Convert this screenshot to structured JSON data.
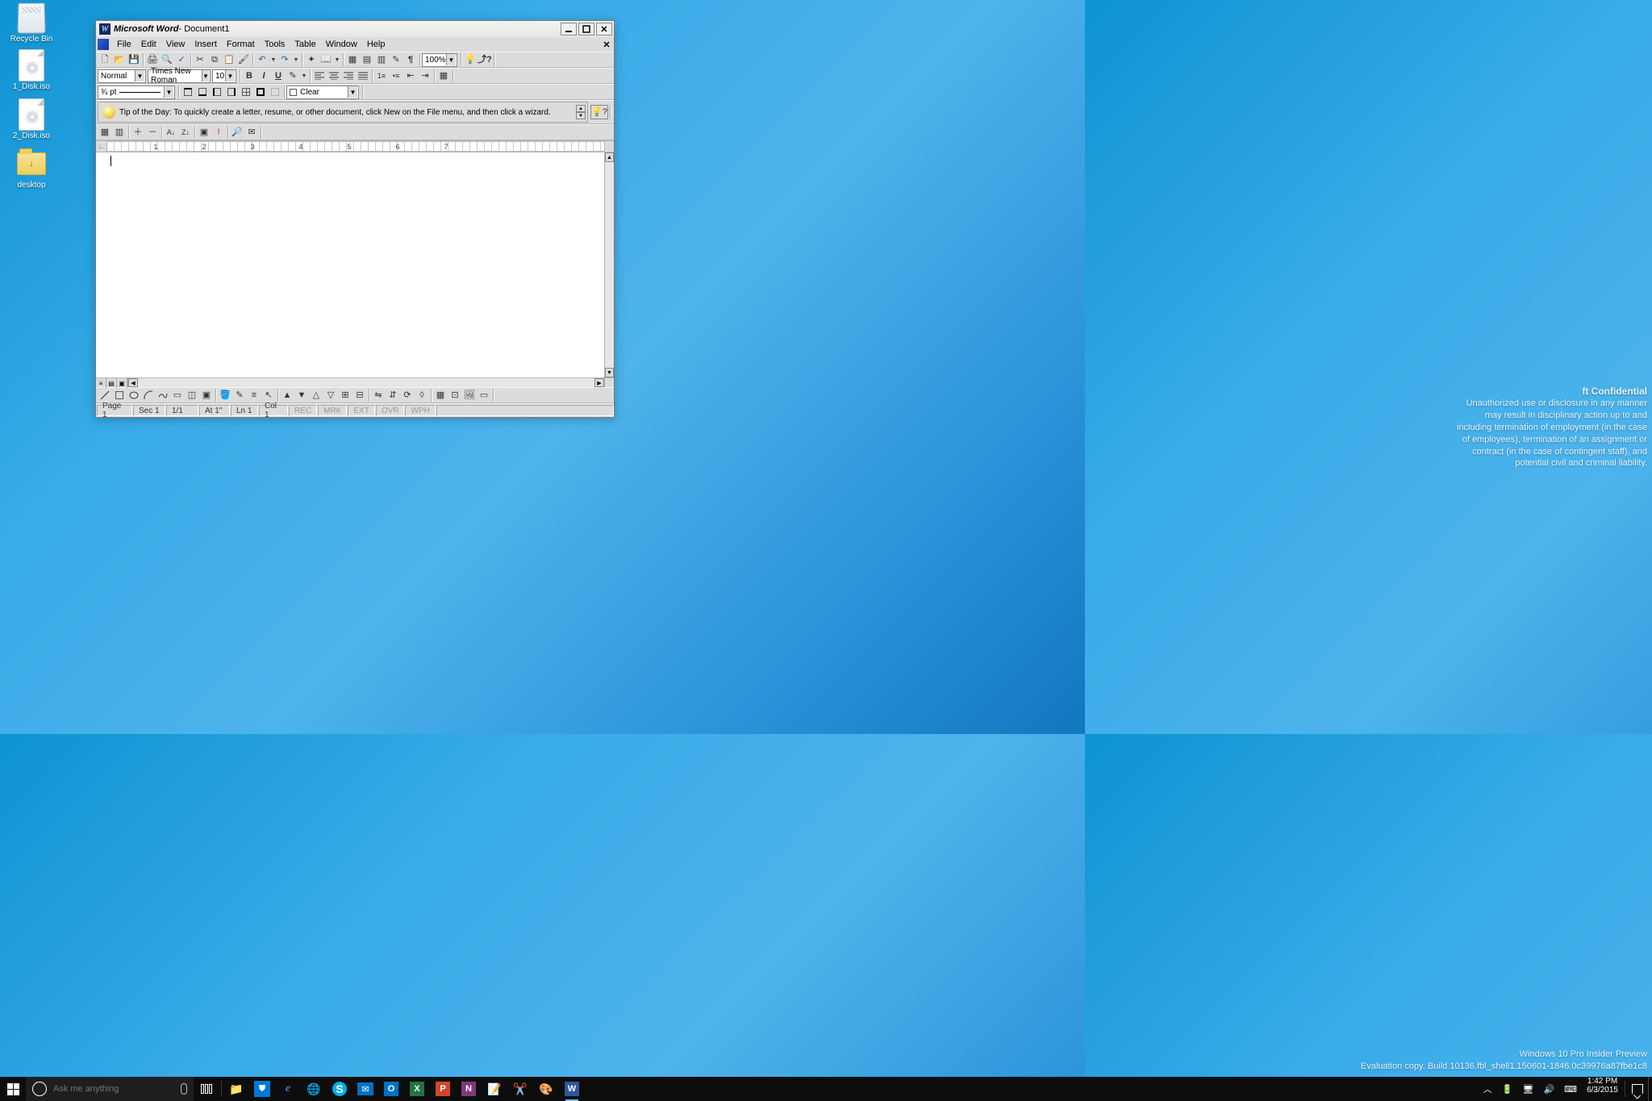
{
  "desktop": {
    "icons": [
      {
        "label": "Recycle Bin"
      },
      {
        "label": "1_Disk.iso"
      },
      {
        "label": "2_Disk.iso"
      },
      {
        "label": "desktop"
      }
    ]
  },
  "confidential": {
    "heading": "ft Confidential",
    "body": "Unauthorized use or disclosure in any manner may result in disciplinary action up to and including termination of employment (in the case of employees), termination of an assignment or contract (in the case of contingent staff), and potential civil and criminal liability.",
    "os": "Windows 10 Pro Insider Preview",
    "build": "Evaluation copy. Build 10136.fbl_shell1.150601-1846.0c39976a87fbe1c8"
  },
  "word": {
    "titlebar": {
      "app": "Microsoft Word",
      "doc": " - Document1"
    },
    "menus": [
      "File",
      "Edit",
      "View",
      "Insert",
      "Format",
      "Tools",
      "Table",
      "Window",
      "Help"
    ],
    "format_toolbar": {
      "style": "Normal",
      "font": "Times New Roman",
      "size": "10"
    },
    "zoom": "100%",
    "border_toolbar": {
      "weight": "¾ pt",
      "style": "Clear"
    },
    "tip": "Tip of the Day: To quickly create a letter, resume, or other document, click New on the File menu, and then click a wizard.",
    "ruler_numbers": [
      "1",
      "2",
      "3",
      "4",
      "5",
      "6",
      "7"
    ],
    "status": {
      "page": "Page 1",
      "sec": "Sec 1",
      "pages": "1/1",
      "at": "At 1\"",
      "ln": "Ln 1",
      "col": "Col 1",
      "modes": [
        "REC",
        "MRK",
        "EXT",
        "OVR",
        "WPH"
      ]
    }
  },
  "taskbar": {
    "search_placeholder": "Ask me anything",
    "time": "1:42 PM",
    "date": "6/3/2015"
  }
}
